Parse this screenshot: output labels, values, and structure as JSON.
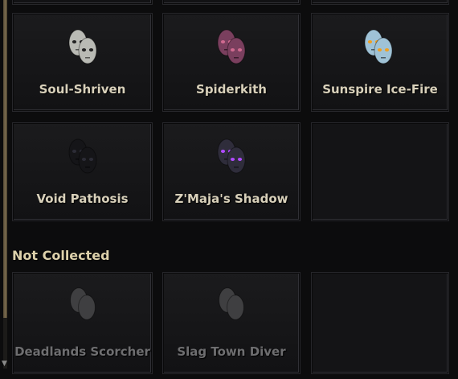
{
  "collected": [
    {
      "name": "Soul-Shriven",
      "icon": "soul-shriven-heads-icon",
      "skin": "#b9bab4",
      "eyes": "#222222"
    },
    {
      "name": "Spiderkith",
      "icon": "spiderkith-heads-icon",
      "skin": "#7a3f5e",
      "eyes": "#d06a90"
    },
    {
      "name": "Sunspire Ice-Fire",
      "icon": "sunspire-ice-fire-heads-icon",
      "skin": "#9fc2d6",
      "eyes": "#f0a020"
    },
    {
      "name": "Void Pathosis",
      "icon": "void-pathosis-heads-icon",
      "skin": "#151518",
      "eyes": "#2c2c36"
    },
    {
      "name": "Z'Maja's Shadow",
      "icon": "zmajas-shadow-heads-icon",
      "skin": "#2f2d3b",
      "eyes": "#b04bff"
    }
  ],
  "not_collected_header": "Not Collected",
  "not_collected": [
    {
      "name": "Deadlands Scorcher",
      "icon": "deadlands-scorcher-silhouette-icon",
      "skin": "#3f3f41"
    },
    {
      "name": "Slag Town Diver",
      "icon": "slag-town-diver-silhouette-icon",
      "skin": "#3f3f41"
    }
  ]
}
